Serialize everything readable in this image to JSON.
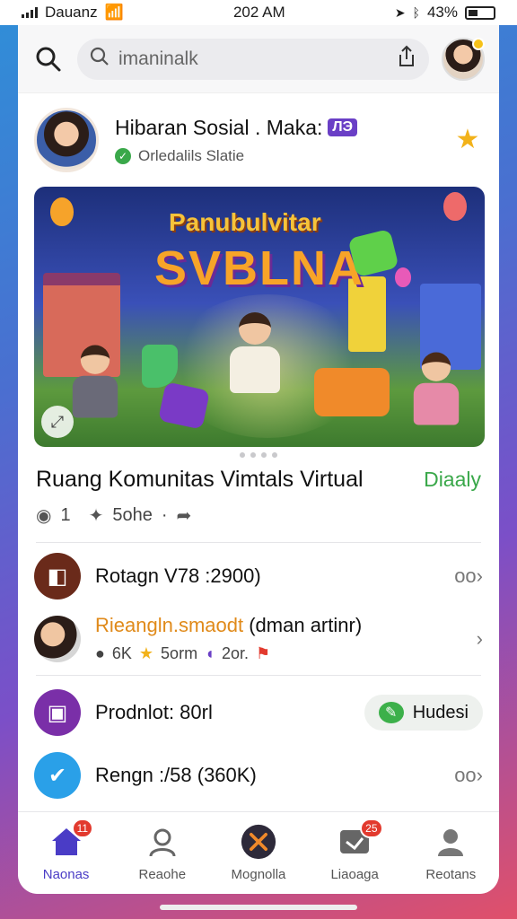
{
  "status_bar": {
    "carrier": "Dauanz",
    "time": "202 AM",
    "battery": "43%"
  },
  "search": {
    "placeholder": "imaninalk"
  },
  "profile": {
    "title": "Hibaran Sosial . Maka:",
    "badge": "ЛЭ",
    "subtitle": "Orledalils Slatie"
  },
  "hero": {
    "title_line1": "Panubulvitar",
    "title_line2": "SVBLNA"
  },
  "section": {
    "title": "Ruang Komunitas Vimtals Virtual",
    "link": "Diaaly",
    "meta_count": "1",
    "meta_label": "5ohe"
  },
  "list": {
    "item1": {
      "title": "Rotagn V78 :2900)",
      "action": "oo"
    },
    "item2": {
      "title_colored": "Rieangln.smaodt",
      "title_rest": " (dman artinr)",
      "stat1": "6K",
      "stat2": "5orm",
      "stat3": "2or."
    },
    "item3": {
      "title": "Prodnlot: 80rl",
      "button": "Hudesi"
    },
    "item4": {
      "title": "Rengn :/58 (360K)",
      "action": "oo"
    }
  },
  "nav": {
    "items": [
      {
        "label": "Naonas",
        "badge": "11"
      },
      {
        "label": "Reaohe"
      },
      {
        "label": "Mognolla"
      },
      {
        "label": "Liaoaga",
        "badge": "25"
      },
      {
        "label": "Reotans"
      }
    ]
  },
  "colors": {
    "accent": "#4a3cc6",
    "green": "#3aa84a",
    "orange": "#e08a1a"
  }
}
